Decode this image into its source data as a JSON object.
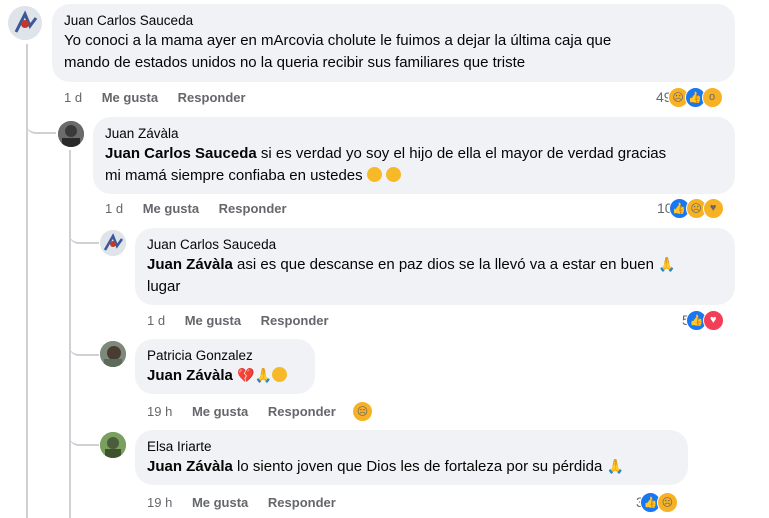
{
  "comments": [
    {
      "author": "Juan Carlos Sauceda",
      "mention": "",
      "text_line1": "Yo conoci a la mama ayer en mArcovia cholute le fuimos a dejar la última caja que",
      "text_line2": "mando de estados unidos no la queria recibir sus familiares que triste",
      "time": "1 d",
      "like_label": "Me gusta",
      "reply_label": "Responder",
      "reaction_count": "49"
    },
    {
      "author": "Juan Závàla",
      "mention": "Juan Carlos Sauceda",
      "text_line1": " si es verdad yo soy el hijo de ella el mayor de verdad gracias",
      "text_line2": "mi mamá siempre confiaba en ustedes",
      "time": "1 d",
      "like_label": "Me gusta",
      "reply_label": "Responder",
      "reaction_count": "10"
    },
    {
      "author": "Juan Carlos Sauceda",
      "mention": "Juan Závàla",
      "text_line1": " asi es que descanse en paz dios se la llevó va a estar en buen",
      "text_line2": "lugar",
      "time": "1 d",
      "like_label": "Me gusta",
      "reply_label": "Responder",
      "reaction_count": "5"
    },
    {
      "author": "Patricia Gonzalez",
      "mention": "Juan Závàla",
      "text_line1": "",
      "time": "19 h",
      "like_label": "Me gusta",
      "reply_label": "Responder"
    },
    {
      "author": "Elsa Iriarte",
      "mention": "Juan Závàla",
      "text_line1": " lo siento joven que Dios les de fortaleza por su pérdida",
      "time": "19 h",
      "like_label": "Me gusta",
      "reply_label": "Responder",
      "reaction_count": "3"
    }
  ],
  "icons": {
    "like": "like-icon",
    "love": "love-icon",
    "sad": "sad-icon",
    "wow": "wow-icon",
    "care": "care-icon",
    "broken_heart": "broken-heart-emoji",
    "pray": "pray-emoji",
    "pensive": "pensive-emoji"
  },
  "colors": {
    "bubble": "#f0f2f5",
    "like": "#1877f2",
    "love": "#f33e58",
    "reaction_yellow": "#f7b125",
    "secondary_text": "#65676b"
  }
}
